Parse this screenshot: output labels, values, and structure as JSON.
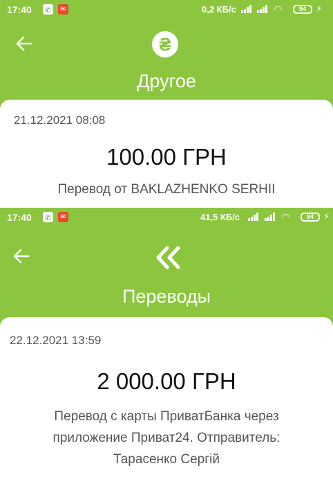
{
  "screens": [
    {
      "status": {
        "time": "17:40",
        "speed": "0,2 КБ/с",
        "battery": "94"
      },
      "title": "Другое",
      "icon": "hryvnia-icon",
      "icon_glyph": "₴",
      "datetime": "21.12.2021 08:08",
      "amount": "100.00 ГРН",
      "description_lines": [
        "Перевод от BAKLAZHENKO SERHII"
      ]
    },
    {
      "status": {
        "time": "17:40",
        "speed": "41,5 КБ/с",
        "battery": "94"
      },
      "title": "Переводы",
      "icon": "double-chevron-left-icon",
      "datetime": "22.12.2021 13:59",
      "amount": "2 000.00 ГРН",
      "description_lines": [
        "Перевод с карты ПриватБанка через",
        "приложение Приват24. Отправитель:",
        "Тарасенко Сергій"
      ]
    }
  ],
  "colors": {
    "header_green": "#8cc63f",
    "card_bg": "#ffffff",
    "text_dark": "#111111",
    "text_muted": "#555555"
  }
}
